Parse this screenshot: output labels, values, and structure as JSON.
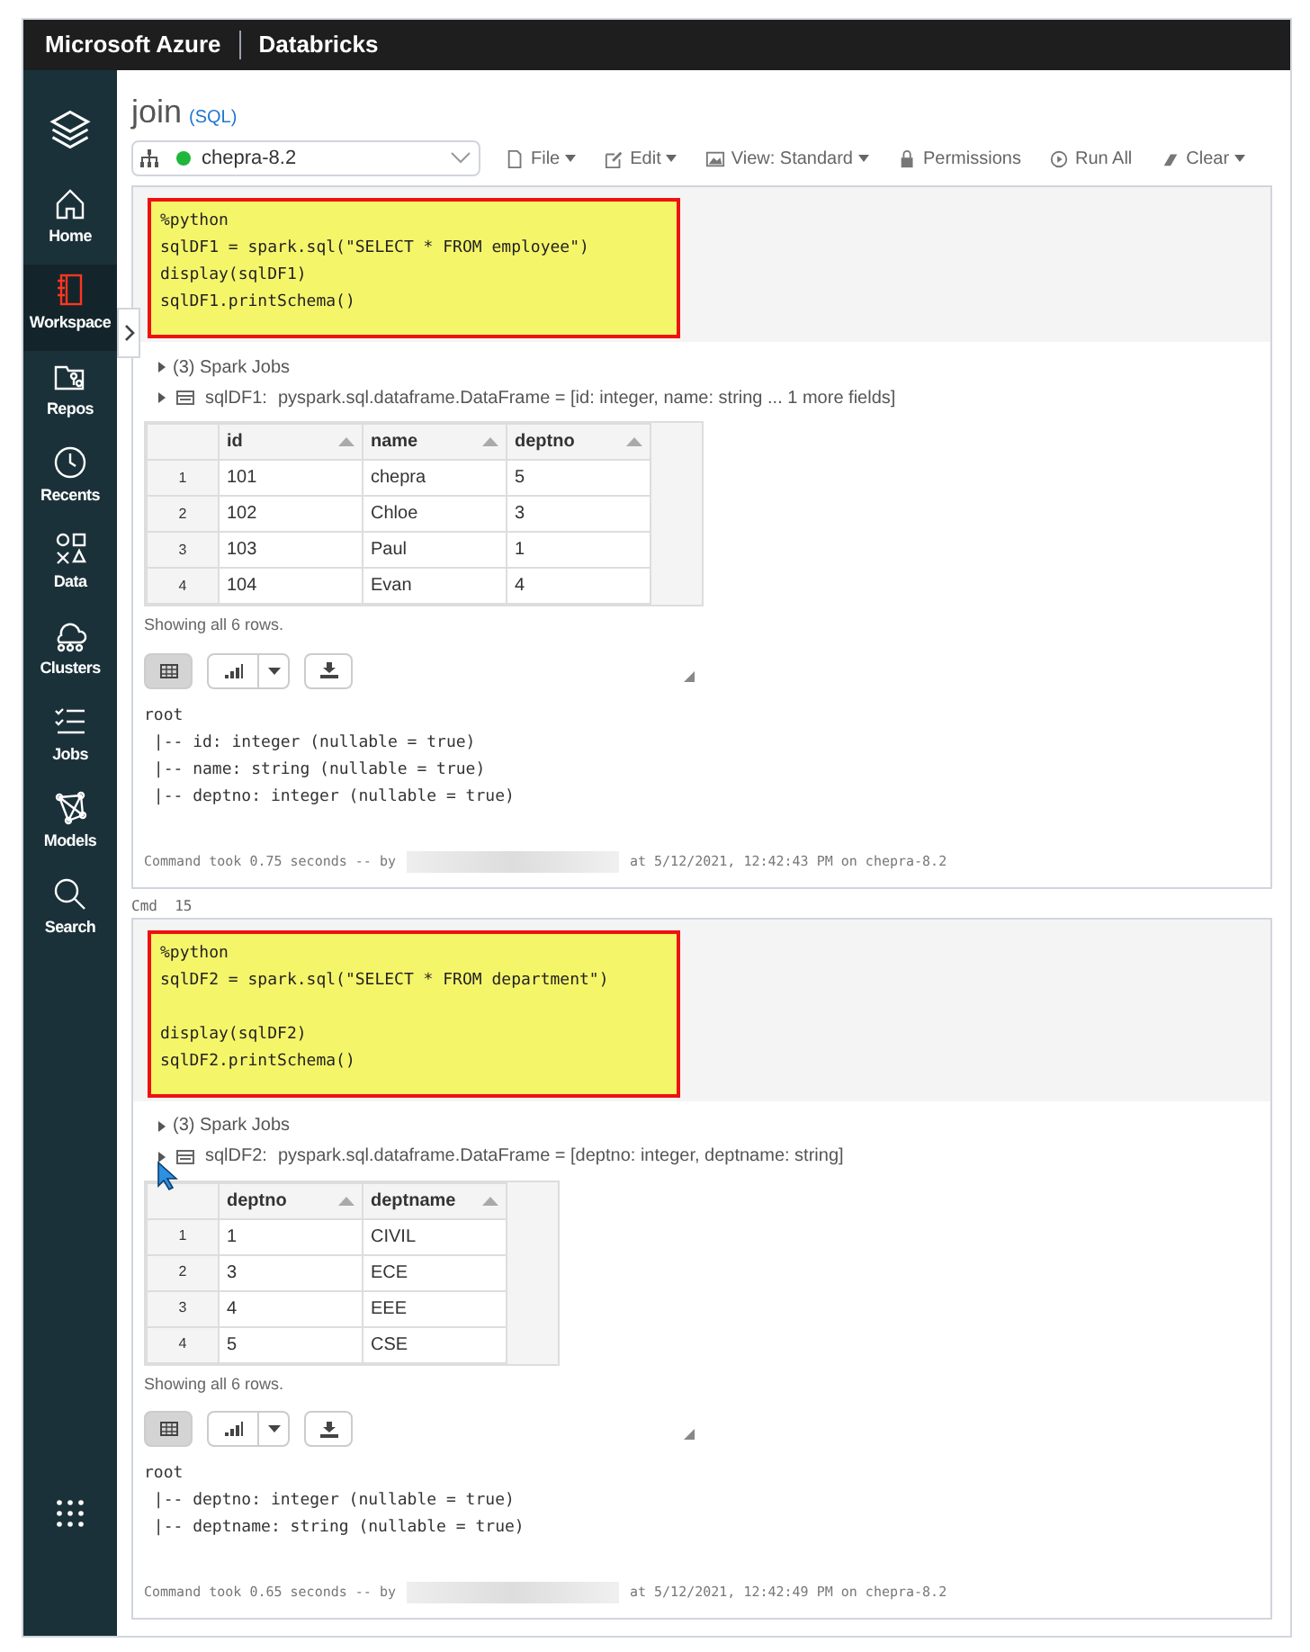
{
  "header": {
    "brand": "Microsoft Azure",
    "product": "Databricks"
  },
  "sidebar": {
    "items": [
      {
        "label": "Home",
        "selected": false
      },
      {
        "label": "Workspace",
        "selected": true
      },
      {
        "label": "Repos",
        "selected": false
      },
      {
        "label": "Recents",
        "selected": false
      },
      {
        "label": "Data",
        "selected": false
      },
      {
        "label": "Clusters",
        "selected": false
      },
      {
        "label": "Jobs",
        "selected": false
      },
      {
        "label": "Models",
        "selected": false
      },
      {
        "label": "Search",
        "selected": false
      }
    ]
  },
  "notebook": {
    "title": "join",
    "language": "(SQL)",
    "cluster": {
      "name": "chepra-8.2",
      "running": true
    },
    "toolbar": [
      {
        "label": "File",
        "dropdown": true
      },
      {
        "label": "Edit",
        "dropdown": true
      },
      {
        "label": "View: Standard",
        "dropdown": true
      },
      {
        "label": "Permissions",
        "dropdown": false
      },
      {
        "label": "Run All",
        "dropdown": false
      },
      {
        "label": "Clear",
        "dropdown": true
      }
    ]
  },
  "cells": [
    {
      "code": [
        [
          "%python",
          "sqlDF1 = spark.sql(\"SELECT * FROM employee\")",
          "display(sqlDF1)",
          "sqlDF1.printSchema()"
        ]
      ],
      "highlighted": true,
      "jobs": "(3) Spark Jobs",
      "dataframe": {
        "name": "sqlDF1:",
        "type": "pyspark.sql.dataframe.DataFrame = [id: integer, name: string ... 1 more fields]"
      },
      "table": {
        "columns": [
          "id",
          "name",
          "deptno"
        ],
        "rows": [
          {
            "index": "1",
            "values": [
              "101",
              "chepra",
              "5"
            ]
          },
          {
            "index": "2",
            "values": [
              "102",
              "Chloe",
              "3"
            ]
          },
          {
            "index": "3",
            "values": [
              "103",
              "Paul",
              "1"
            ]
          },
          {
            "index": "4",
            "values": [
              "104",
              "Evan",
              "4"
            ]
          }
        ]
      },
      "row_count": "Showing all 6 rows.",
      "view": [
        {
          "selected": true
        },
        {
          "selected": false
        }
      ],
      "schema": [
        "root",
        " |-- id: integer (nullable = true)",
        " |-- name: string (nullable = true)",
        " |-- deptno: integer (nullable = true)"
      ],
      "footer": {
        "before": "Command took 0.75 seconds -- by",
        "after": "at 5/12/2021, 12:42:43 PM on chepra-8.2"
      }
    },
    {
      "label": "Cmd  15",
      "code": [
        [
          "%python",
          "sqlDF2 = spark.sql(\"SELECT * FROM department\")"
        ],
        [
          "display(sqlDF2)",
          "sqlDF2.printSchema()"
        ]
      ],
      "highlighted": true,
      "jobs": "(3) Spark Jobs",
      "dataframe": {
        "name": "sqlDF2:",
        "type": "pyspark.sql.dataframe.DataFrame = [deptno: integer, deptname: string]"
      },
      "table": {
        "columns": [
          "deptno",
          "deptname"
        ],
        "rows": [
          {
            "index": "1",
            "values": [
              "1",
              "CIVIL"
            ]
          },
          {
            "index": "2",
            "values": [
              "3",
              "ECE"
            ]
          },
          {
            "index": "3",
            "values": [
              "4",
              "EEE"
            ]
          },
          {
            "index": "4",
            "values": [
              "5",
              "CSE"
            ]
          }
        ]
      },
      "row_count": "Showing all 6 rows.",
      "view": [
        {
          "selected": true
        },
        {
          "selected": false
        }
      ],
      "schema": [
        "root",
        " |-- deptno: integer (nullable = true)",
        " |-- deptname: string (nullable = true)"
      ],
      "footer": {
        "before": "Command took 0.65 seconds -- by",
        "after": "at 5/12/2021, 12:42:49 PM on chepra-8.2"
      }
    }
  ]
}
